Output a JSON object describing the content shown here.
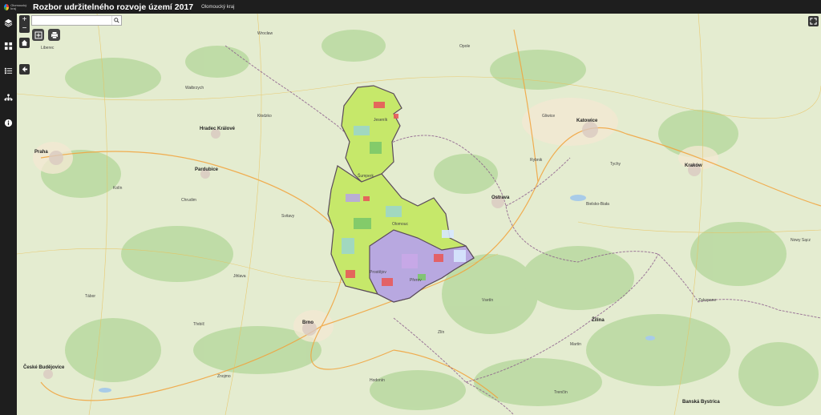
{
  "header": {
    "logo_text": "Olomoucký kraj",
    "title": "Rozbor udržitelného rozvoje území 2017",
    "subtitle": "Olomoucký kraj"
  },
  "search": {
    "value": "",
    "placeholder": ""
  },
  "zoom": {
    "in_label": "+",
    "out_label": "−"
  },
  "map_labels": {
    "cities": [
      "Praha",
      "Hradec Králové",
      "Pardubice",
      "Brno",
      "Ostrava",
      "Katowice",
      "Kraków",
      "Žilina",
      "České Budějovice",
      "Banská Bystrica"
    ],
    "places": [
      "Wrocław",
      "Opole",
      "Gliwice",
      "Bielsko-Biała",
      "Jihlava",
      "Zlín",
      "Olomouc",
      "Přerov",
      "Prostějov",
      "Šumperk",
      "Jeseník",
      "Trenčín",
      "Nowy Sącz",
      "Liberec",
      "Wałbrzych",
      "Kłodzko",
      "Rybnik",
      "Tychy",
      "Zakopane",
      "Martin",
      "Třebíč",
      "Znojmo",
      "Hodonín",
      "Tábor",
      "Kolín",
      "Chrudim",
      "Svitavy",
      "Vsetín"
    ]
  },
  "colors": {
    "header_bg": "#1e1e1e",
    "map_bg": "#e4ecd0",
    "border": "#7a3b6b",
    "region_green": "#c6e86a",
    "region_purple": "#b8a8e0",
    "region_red": "#e85a5a"
  },
  "icons": {
    "sidebar": [
      "layers-icon",
      "grid-icon",
      "legend-icon",
      "org-chart-icon",
      "info-icon"
    ],
    "tools": [
      "home-icon",
      "collapse-arrow-icon",
      "zoom-extent-icon",
      "print-icon",
      "fullscreen-icon",
      "search-icon"
    ]
  }
}
